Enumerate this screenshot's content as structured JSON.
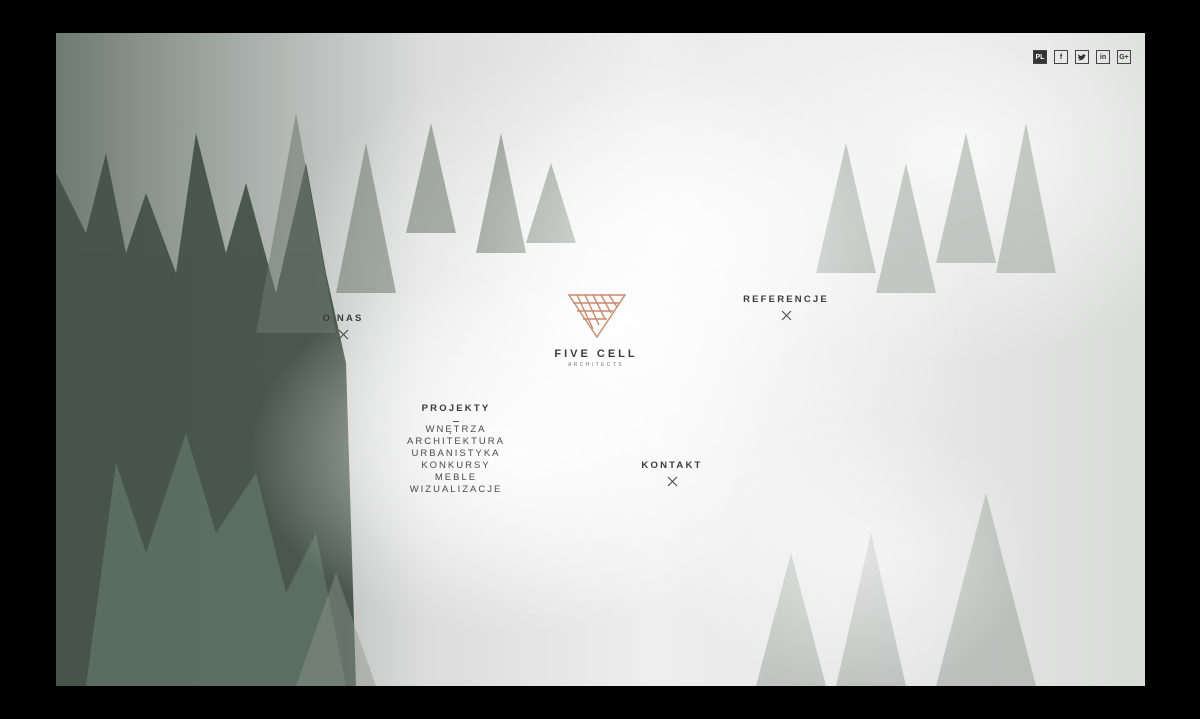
{
  "brand": {
    "name": "FIVE CELL",
    "tagline": "ARCHITECTS",
    "accent_color": "#c98a6e"
  },
  "nav": {
    "o_nas": "O NAS",
    "referencje": "REFERENCJE",
    "projekty": "PROJEKTY",
    "kontakt": "KONTAKT",
    "projekty_sub": [
      "WNĘTRZA",
      "ARCHITEKTURA",
      "URBANISTYKA",
      "KONKURSY",
      "MEBLE",
      "WIZUALIZACJE"
    ]
  },
  "social": {
    "lang": "PL",
    "facebook": "f",
    "twitter_icon": "twitter-icon",
    "linkedin": "in",
    "googleplus": "G+"
  }
}
